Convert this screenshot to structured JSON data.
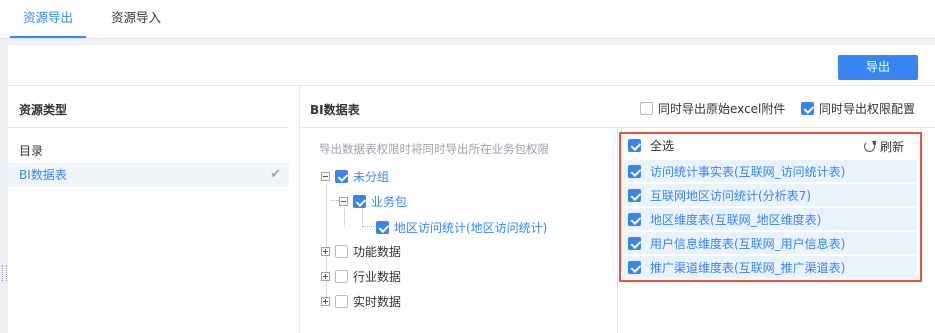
{
  "tabs": [
    {
      "label": "资源导出",
      "active": true
    },
    {
      "label": "资源导入",
      "active": false
    }
  ],
  "toolbar": {
    "export_label": "导出"
  },
  "left": {
    "title": "资源类型",
    "items": [
      {
        "label": "目录",
        "selected": false
      },
      {
        "label": "BI数据表",
        "selected": true
      }
    ]
  },
  "middle": {
    "title": "BI数据表",
    "options": [
      {
        "label": "同时导出原始excel附件",
        "checked": false
      },
      {
        "label": "同时导出权限配置",
        "checked": true
      }
    ],
    "hint": "导出数据表权限时将同时导出所在业务包权限",
    "tree": [
      {
        "label": "未分组",
        "checked": true,
        "expanded": true
      },
      {
        "label": "业务包",
        "checked": true,
        "expanded": true
      },
      {
        "label": "地区访问统计(地区访问统计)",
        "checked": true
      },
      {
        "label": "功能数据",
        "checked": false,
        "expanded": false
      },
      {
        "label": "行业数据",
        "checked": false,
        "expanded": false
      },
      {
        "label": "实时数据",
        "checked": false,
        "expanded": false
      }
    ]
  },
  "right": {
    "select_all_label": "全选",
    "refresh_label": "刷新",
    "tables": [
      {
        "label": "访问统计事实表(互联网_访问统计表)",
        "checked": true
      },
      {
        "label": "互联网地区访问统计(分析表7)",
        "checked": true
      },
      {
        "label": "地区维度表(互联网_地区维度表)",
        "checked": true
      },
      {
        "label": "用户信息维度表(互联网_用户信息表)",
        "checked": true
      },
      {
        "label": "推广渠道维度表(互联网_推广渠道表)",
        "checked": true
      }
    ]
  },
  "colors": {
    "accent": "#3685f2",
    "highlight_border": "#e8513d"
  }
}
